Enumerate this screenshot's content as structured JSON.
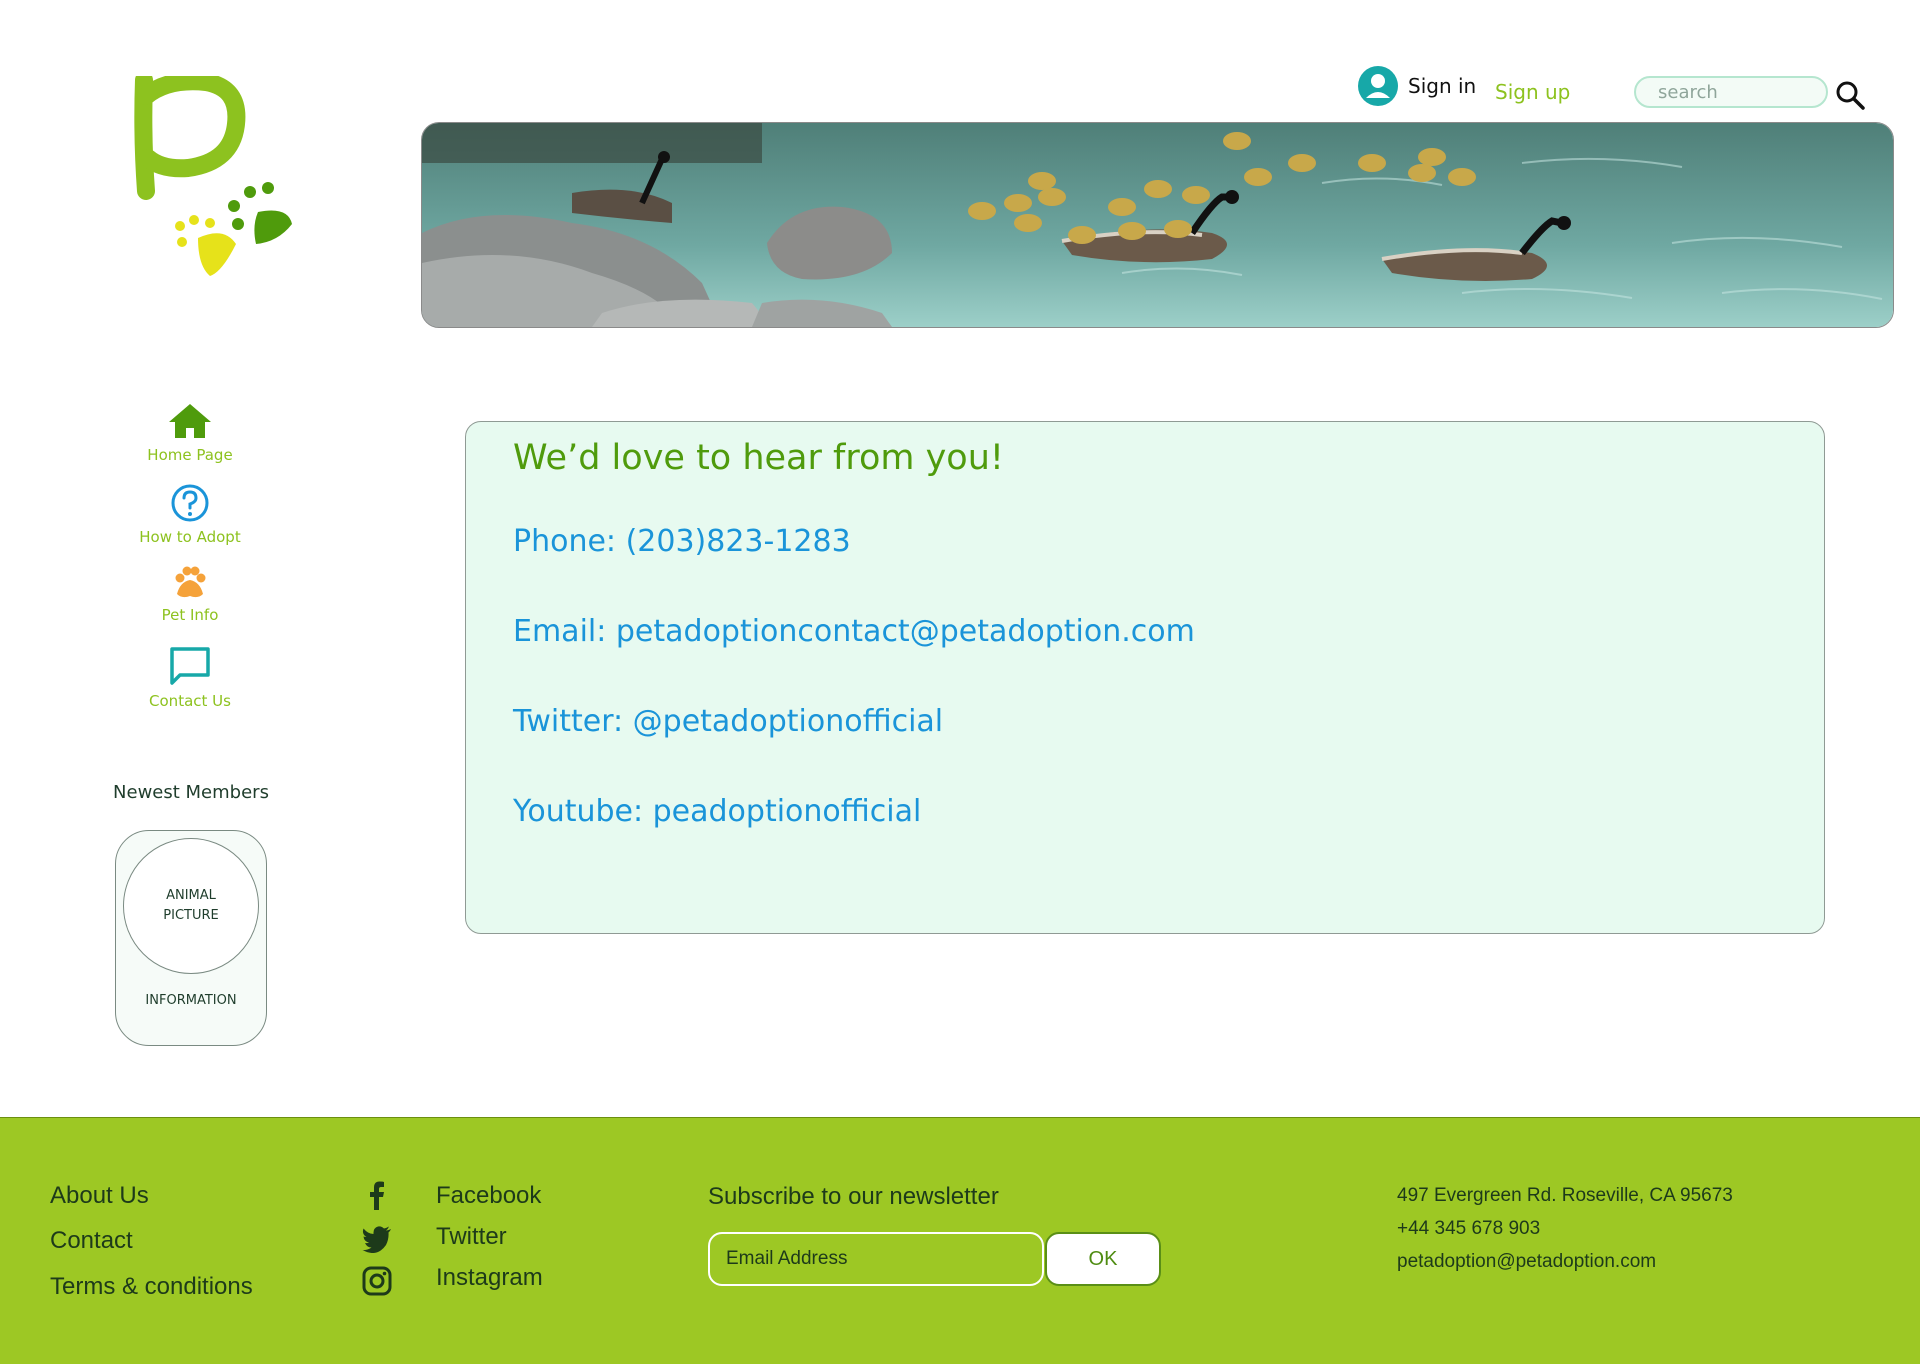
{
  "header": {
    "sign_in": "Sign in",
    "sign_up": "Sign up",
    "search_placeholder": "search"
  },
  "nav": {
    "items": [
      {
        "label": "Home Page",
        "icon": "home-icon",
        "color": "#4f9b0c"
      },
      {
        "label": "How to Adopt",
        "icon": "question-icon",
        "color": "#1a94d9"
      },
      {
        "label": "Pet Info",
        "icon": "paw-icon",
        "color": "#f5a23a"
      },
      {
        "label": "Contact Us",
        "icon": "chat-icon",
        "color": "#17a8a8"
      }
    ]
  },
  "sidebar": {
    "newest_title": "Newest Members",
    "member_picture": "ANIMAL PICTURE",
    "member_info": "INFORMATION"
  },
  "contact": {
    "title": "We’d love to hear from you!",
    "phone": "Phone: (203)823-1283",
    "email": "Email: petadoptioncontact@petadoption.com",
    "twitter": "Twitter: @petadoptionofficial",
    "youtube": "Youtube: peadoptionofficial"
  },
  "footer": {
    "links": [
      "About Us",
      "Contact",
      "Terms & conditions"
    ],
    "social": [
      {
        "label": "Facebook",
        "icon": "facebook-icon"
      },
      {
        "label": "Twitter",
        "icon": "twitter-icon"
      },
      {
        "label": "Instagram",
        "icon": "instagram-icon"
      }
    ],
    "newsletter_title": "Subscribe to our newsletter",
    "email_placeholder": "Email Address",
    "ok_label": "OK",
    "address": "497 Evergreen Rd. Roseville, CA 95673",
    "phone": "+44 345 678 903",
    "email": "petadoption@petadoption.com"
  },
  "colors": {
    "brand_green": "#9dc824",
    "dark_green": "#4f9b0c",
    "link_blue": "#1a94d9",
    "panel_bg": "#e7faf0"
  }
}
